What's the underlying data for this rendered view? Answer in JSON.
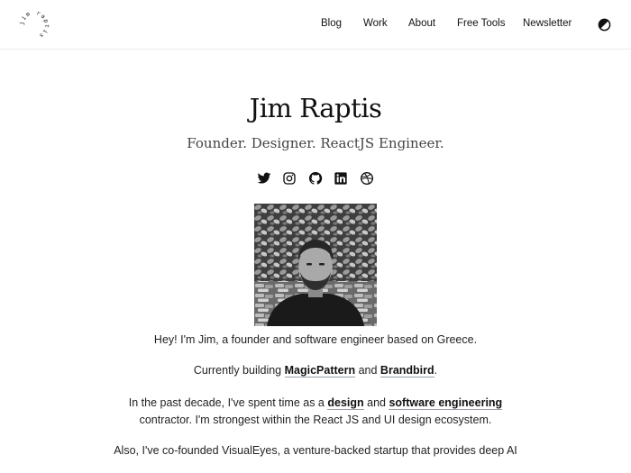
{
  "logo": {
    "text": "jim raptis",
    "icon": "circular-text-logo"
  },
  "nav": {
    "items": [
      {
        "label": "Blog"
      },
      {
        "label": "Work"
      },
      {
        "label": "About"
      },
      {
        "label": "Free Tools"
      },
      {
        "label": "Newsletter"
      }
    ],
    "theme_icon": "half-moon-contrast-icon"
  },
  "hero": {
    "name": "Jim Raptis",
    "tagline": "Founder. Designer. ReactJS Engineer."
  },
  "socials": [
    {
      "icon": "twitter-icon"
    },
    {
      "icon": "instagram-icon"
    },
    {
      "icon": "github-icon"
    },
    {
      "icon": "linkedin-icon"
    },
    {
      "icon": "dribbble-icon"
    }
  ],
  "portrait": {
    "description_icon": "profile-photo"
  },
  "bio": {
    "p1": "Hey! I'm Jim, a founder and software engineer based on Greece.",
    "p2_pre": "Currently building ",
    "p2_link1": "MagicPattern",
    "p2_mid": " and ",
    "p2_link2": "Brandbird",
    "p2_post": ".",
    "p3_pre": "In the past decade, I've spent time as a ",
    "p3_link1": "design",
    "p3_mid": " and ",
    "p3_link2": "software engineering",
    "p3_post": " contractor. I'm strongest within the React JS and UI design ecosystem.",
    "p4": "Also, I've co-founded VisualEyes, a venture-backed startup that provides deep AI"
  }
}
